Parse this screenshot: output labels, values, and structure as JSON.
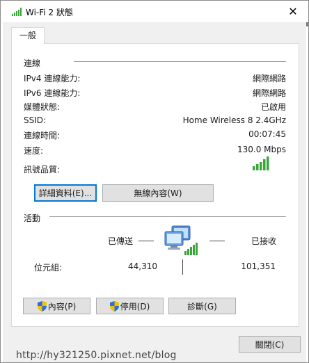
{
  "window": {
    "title": "Wi-Fi 2 狀態",
    "close_glyph": "✕"
  },
  "tab": {
    "label": "一般"
  },
  "connection": {
    "section_title": "連線",
    "rows": [
      {
        "label": "IPv4 連線能力:",
        "value": "網際網路"
      },
      {
        "label": "IPv6 連線能力:",
        "value": "網際網路"
      },
      {
        "label": "媒體狀態:",
        "value": "已啟用"
      },
      {
        "label": "SSID:",
        "value": "Home Wireless 8 2.4GHz"
      },
      {
        "label": "連線時間:",
        "value": "00:07:45"
      },
      {
        "label": "速度:",
        "value": "130.0 Mbps"
      }
    ],
    "signal_label": "訊號品質:",
    "signal_bars_filled": 5,
    "signal_bars_total": 5,
    "details_button": "詳細資料(E)...",
    "wireless_button": "無線內容(W)"
  },
  "activity": {
    "section_title": "活動",
    "sent_label": "已傳送",
    "received_label": "已接收",
    "bytes_label": "位元組:",
    "bytes_sent": "44,310",
    "bytes_received": "101,351"
  },
  "actions": {
    "properties_button": "內容(P)",
    "disable_button": "停用(D)",
    "diagnose_button": "診斷(G)",
    "close_button": "關閉(C)"
  },
  "watermark": "http://hy321250.pixnet.net/blog",
  "colors": {
    "signal_green": "#3aa53a",
    "focus_blue": "#0078d7",
    "button_face": "#e1e1e1",
    "shield_blue": "#2a6fdb",
    "shield_yellow": "#f2c200"
  },
  "icons": {
    "title": "wifi-signal-icon",
    "network": "network-computers-icon",
    "shield": "uac-shield-icon"
  }
}
